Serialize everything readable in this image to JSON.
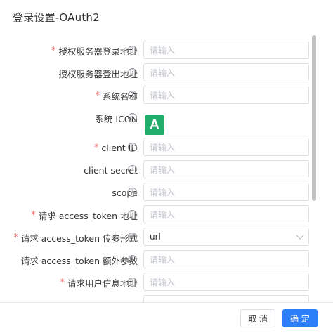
{
  "dialog": {
    "title": "登录设置-OAuth2"
  },
  "help_glyph": "?",
  "fields": [
    {
      "label": "授权服务器登录地址",
      "required": true,
      "placeholder": "请输入"
    },
    {
      "label": "授权服务器登出地址",
      "required": false,
      "placeholder": "请输入"
    },
    {
      "label": "系统名称",
      "required": true,
      "placeholder": "请输入"
    },
    {
      "label": "系统 ICON",
      "required": false,
      "icon_letter": "A",
      "icon_color": "#21ad6b"
    },
    {
      "label": "client ID",
      "required": true,
      "placeholder": "请输入"
    },
    {
      "label": "client secret",
      "required": false,
      "placeholder": "请输入"
    },
    {
      "label": "scope",
      "required": false,
      "placeholder": "请输入"
    },
    {
      "label": "请求 access_token 地址",
      "required": true,
      "placeholder": "请输入"
    },
    {
      "label": "请求 access_token 传参形式",
      "required": true,
      "value": "url"
    },
    {
      "label": "请求 access_token 额外参数",
      "required": false,
      "placeholder": "请输入"
    },
    {
      "label": "请求用户信息地址",
      "required": true,
      "placeholder": "请输入"
    }
  ],
  "required_mark": "*",
  "footer": {
    "cancel_label": "取 消",
    "ok_label": "确 定"
  },
  "colors": {
    "primary": "#2d7ff9",
    "required": "#f56c6c",
    "icon_bg": "#21ad6b"
  }
}
